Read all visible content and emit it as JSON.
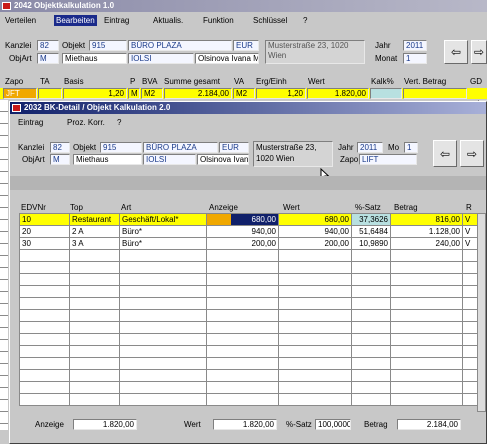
{
  "back_window": {
    "title": "2042 Objektkalkulation 1.0",
    "menu": [
      "Verteilen",
      "Bearbeiten",
      "Eintrag",
      "Aktualis.",
      "Funktion",
      "Schlüssel",
      "?"
    ],
    "kanzlei_label": "Kanzlei",
    "kanzlei": "82",
    "objekt_label": "Objekt",
    "objekt": "915",
    "objekt_name": "BÜRO PLAZA",
    "currency": "EUR",
    "address": "Musterstraße 23, 1020 Wien",
    "jahr_label": "Jahr",
    "jahr": "2011",
    "monat_label": "Monat",
    "monat": "1",
    "objart_label": "ObjArt",
    "objart": "M",
    "owner": "Miethaus",
    "code": "IOLSI",
    "person": "Olsinova Ivana Ma",
    "col_headers": [
      "Zapo",
      "TA",
      "Basis",
      "P",
      "BVA",
      "Summe gesamt",
      "VA",
      "Erg/Einh",
      "Wert",
      "Kalk%",
      "Vert. Betrag",
      "GD"
    ],
    "row": {
      "zapo": "JFT",
      "basis": "1,20",
      "p": "M",
      "bva": "M2",
      "summe": "2.184,00",
      "va": "M2",
      "erg": "1,20",
      "wert": "1.820,00"
    }
  },
  "front_window": {
    "title": "2032 BK-Detail / Objekt Kalkulation 2.0",
    "menu": [
      "Eintrag",
      "Proz. Korr.",
      "?"
    ],
    "kanzlei_label": "Kanzlei",
    "kanzlei": "82",
    "objekt_label": "Objekt",
    "objekt": "915",
    "objekt_name": "BÜRO PLAZA",
    "currency": "EUR",
    "address": "Musterstraße 23,\n1020 Wien",
    "jahr_label": "Jahr",
    "jahr": "2011",
    "mo_label": "Mo",
    "mo": "1",
    "zapo_label": "Zapo",
    "zapo": "LIFT",
    "objart_label": "ObjArt",
    "objart": "M",
    "owner": "Miethaus",
    "code": "IOLSI",
    "person": "Olsinova Ivana",
    "headers": [
      "EDVNr",
      "Top",
      "Art",
      "Anzeige",
      "Wert",
      "%-Satz",
      "Betrag",
      "R"
    ],
    "rows": [
      {
        "edv": "10",
        "top": "Restaurant",
        "art": "Geschäft/Lokal*",
        "anzeige": "680,00",
        "wert": "680,00",
        "satz": "37,3626",
        "betrag": "816,00",
        "r": "V"
      },
      {
        "edv": "20",
        "top": "2 A",
        "art": "Büro*",
        "anzeige": "940,00",
        "wert": "940,00",
        "satz": "51,6484",
        "betrag": "1.128,00",
        "r": "V"
      },
      {
        "edv": "30",
        "top": "3 A",
        "art": "Büro*",
        "anzeige": "200,00",
        "wert": "200,00",
        "satz": "10,9890",
        "betrag": "240,00",
        "r": "V"
      }
    ],
    "footer": {
      "anzeige_label": "Anzeige",
      "anzeige": "1.820,00",
      "wert_label": "Wert",
      "wert": "1.820,00",
      "satz_label": "%-Satz",
      "satz": "100,0000",
      "betrag_label": "Betrag",
      "betrag": "2.184,00"
    }
  },
  "colors": {
    "yellow": "#ffff00",
    "orange": "#f0a800",
    "navy": "#10206a",
    "teal": "#b8e0e0",
    "title_bg": "#6a6a8c"
  }
}
